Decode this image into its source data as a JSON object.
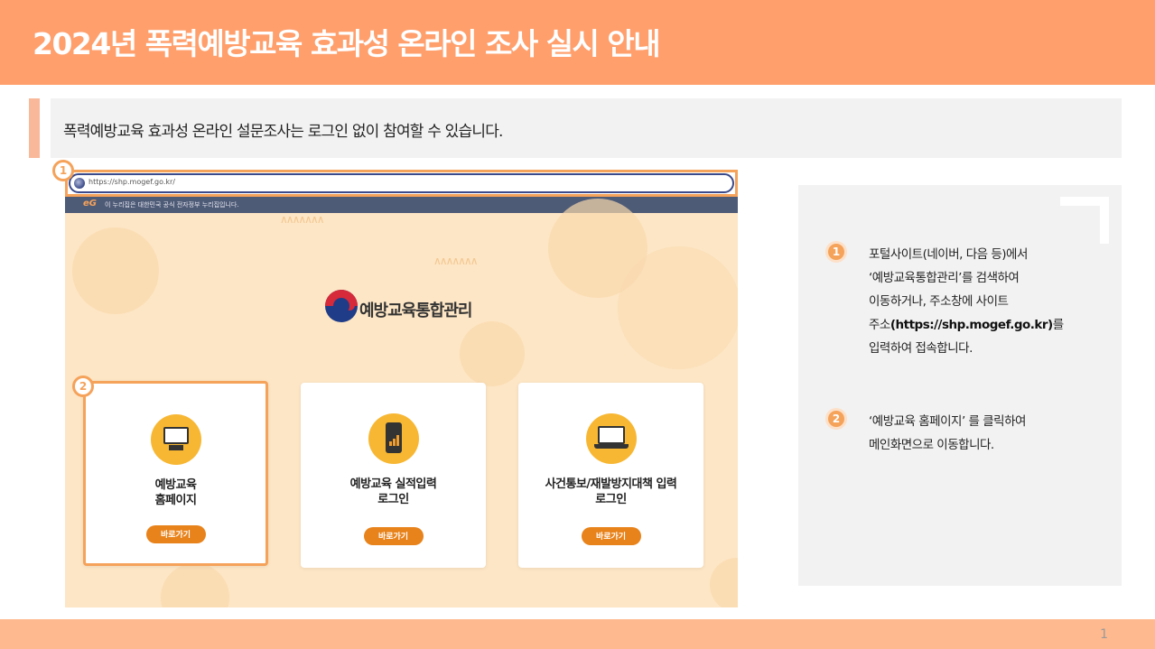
{
  "header": {
    "title": "2024년 폭력예방교육 효과성 온라인 조사 실시 안내"
  },
  "intro": {
    "text": "폭력예방교육 효과성 온라인 설문조사는 로그인 없이 참여할 수 있습니다."
  },
  "screenshot": {
    "browser": {
      "url": "https://shp.mogef.go.kr/"
    },
    "gov_banner": {
      "logo": "eG",
      "text": "이 누리집은 대한민국 공식 전자정부 누리집입니다."
    },
    "site_logo": {
      "text": "예방교육통합관리"
    },
    "cards": [
      {
        "title_line1": "예방교육",
        "title_line2": "홈페이지",
        "button": "바로가기",
        "icon": "monitor-icon"
      },
      {
        "title_line1": "예방교육 실적입력",
        "title_line2": "로그인",
        "button": "바로가기",
        "icon": "tablet-chart-icon"
      },
      {
        "title_line1": "사건통보/재발방지대책 입력",
        "title_line2": "로그인",
        "button": "바로가기",
        "icon": "laptop-icon"
      }
    ],
    "markers": [
      "1",
      "2"
    ]
  },
  "instructions": {
    "step1": {
      "number": "1",
      "line1": "포털사이트(네이버, 다음 등)에서",
      "line2": "‘예방교육통합관리’를 검색하여",
      "line3": "이동하거나, 주소창에 사이트",
      "line4_pre": "주소",
      "line4_url": "(https://shp.mogef.go.kr)",
      "line4_post": "를",
      "line5": "입력하여 접속합니다."
    },
    "step2": {
      "number": "2",
      "line1": "‘예방교육 홈페이지’ 를 클릭하여",
      "line2": "메인화면으로 이동합니다."
    }
  },
  "footer": {
    "page_number": "1"
  },
  "colors": {
    "header": "#ff9f6c",
    "accent": "#f5a25a",
    "button": "#e8821a",
    "footer": "#ffb98f"
  }
}
